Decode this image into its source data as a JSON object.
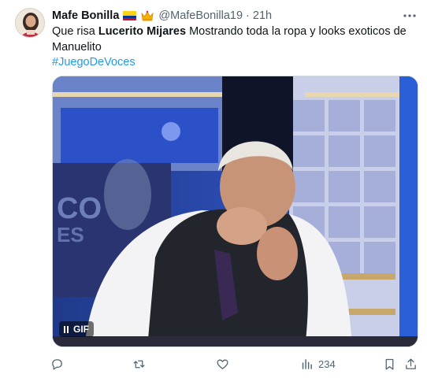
{
  "tweet": {
    "author_name": "Mafe Bonilla",
    "handle": "@MafeBonilla19",
    "separator": "·",
    "time": "21h",
    "text_before": "Que risa ",
    "text_bold": "Lucerito Mijares",
    "text_after": " Mostrando toda la ropa y looks exoticos de Manuelito",
    "hashtag": "#JuegoDeVoces",
    "media_badge": "GIF",
    "views_count": "234"
  },
  "icons": {
    "flag": "colombia-flag-icon",
    "crown": "crown-icon",
    "more": "more-icon",
    "reply": "reply-icon",
    "retweet": "retweet-icon",
    "like": "like-icon",
    "views": "views-icon",
    "bookmark": "bookmark-icon",
    "share": "share-icon"
  },
  "colors": {
    "link": "#1d9bf0",
    "secondary_text": "#536471",
    "primary_text": "#0f1419"
  }
}
